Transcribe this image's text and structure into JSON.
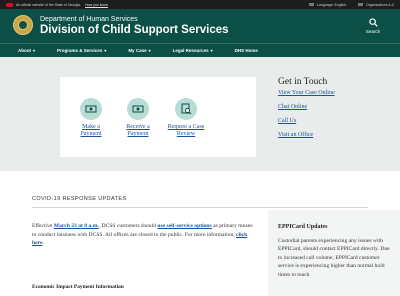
{
  "govbar": {
    "official_text": "An official website of the State of Georgia.",
    "how_you_know": "How you know",
    "language": "Language: English",
    "organizations": "Organizations A-Z"
  },
  "header": {
    "subtitle": "Department of Human Services",
    "title": "Division of Child Support Services",
    "search_label": "Search"
  },
  "nav": {
    "items": [
      {
        "label": "About",
        "chevron": "▾"
      },
      {
        "label": "Programs & Services",
        "chevron": "▾"
      },
      {
        "label": "My Case",
        "chevron": "▾"
      },
      {
        "label": "Legal Resources",
        "chevron": "▾"
      },
      {
        "label": "DHS Home",
        "chevron": ""
      }
    ]
  },
  "actions": [
    {
      "label_line1": "Make a",
      "label_line2": "Payment",
      "icon": "dollar-bill-icon"
    },
    {
      "label_line1": "Receive a",
      "label_line2": "Payment",
      "icon": "dollar-bill-icon"
    },
    {
      "label_line1": "Request a Case",
      "label_line2": "Review",
      "icon": "document-search-icon"
    }
  ],
  "touch": {
    "heading": "Get in Touch",
    "links": [
      "View Your Case Online",
      "Chat Online",
      "Call Us",
      "Visit an Office"
    ]
  },
  "covid": {
    "heading": "COVID-19 RESPONSE UPDATES",
    "p_effective": "Effective ",
    "p_date": "March 23 at 8 a.m.",
    "p_mid": ", DCSS customers should ",
    "p_link": "use self-service options",
    "p_rest": " as primary means to conduct business with DCSS. All offices are closed to the public. For more information, ",
    "p_click": "click here",
    "p_end": "."
  },
  "economic": {
    "heading": "Economic Impact Payment Information"
  },
  "eppicard": {
    "heading": "EPPICard Updates",
    "text": "Custodial parents experiencing any issues with EPPICard, should contact EPPICard directly. Due to increased call volume, EPPICard customer service is experiencing higher than normal hold times to reach"
  },
  "colors": {
    "brand_green": "#0c4f47",
    "icon_circle": "#b9dcd7",
    "link_blue": "#1d4f9a",
    "hero_bg": "#e8eceb"
  }
}
